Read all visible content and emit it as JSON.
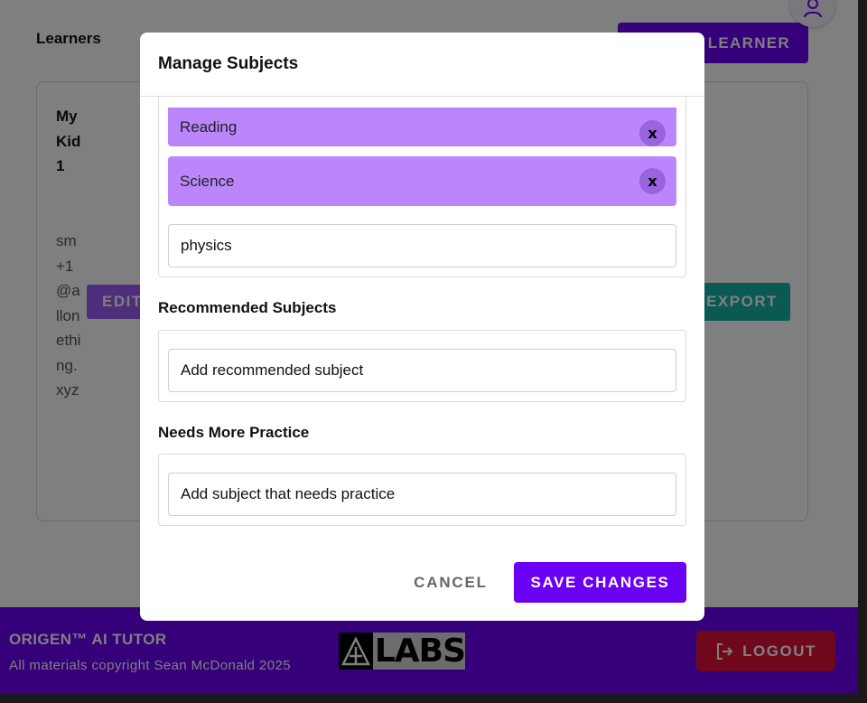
{
  "page": {
    "title": "Learners",
    "add_learner_label": "LEARNER",
    "learner": {
      "name": "MyKid1",
      "email": "sm+1@allonething.xyz",
      "edit_label": "EDIT",
      "export_label": "EXPORT"
    }
  },
  "footer": {
    "brand": "ORIGEN™ AI TUTOR",
    "copyright": "All materials copyright Sean McDonald 2025",
    "logo_text": "LABS",
    "logout_label": "LOGOUT"
  },
  "modal": {
    "title": "Manage Subjects",
    "subjects": [
      {
        "label": "Reading",
        "remove_label": "x"
      },
      {
        "label": "Science",
        "remove_label": "x"
      }
    ],
    "subject_input_value": "physics",
    "recommended": {
      "heading": "Recommended Subjects",
      "placeholder": "Add recommended subject"
    },
    "practice": {
      "heading": "Needs More Practice",
      "placeholder": "Add subject that needs practice"
    },
    "cancel_label": "CANCEL",
    "save_label": "SAVE CHANGES"
  },
  "colors": {
    "primary": "#6a00f4",
    "chip": "#bb86fc",
    "logout": "#e0113b",
    "export": "#17b3a6",
    "edit": "#9b5cf6"
  },
  "icons": [
    "user-icon",
    "close-icon",
    "logout-icon",
    "labs-logo-icon"
  ]
}
